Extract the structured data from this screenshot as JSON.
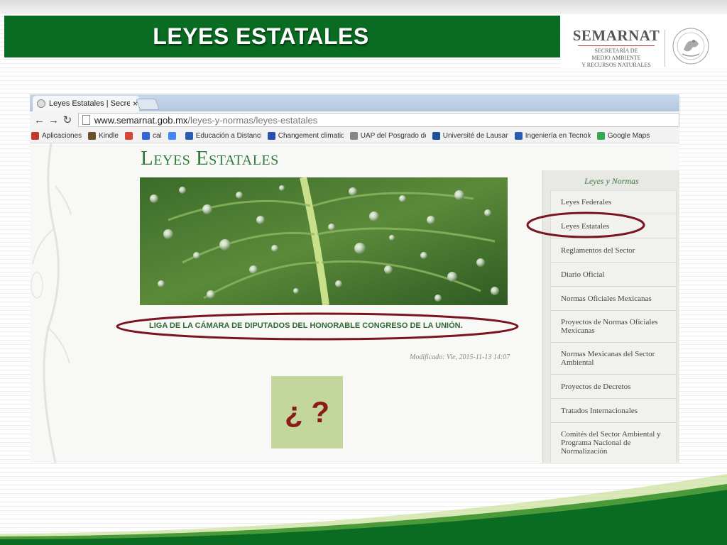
{
  "slide": {
    "title": "LEYES ESTATALES",
    "logo": {
      "name": "SEMARNAT",
      "subtitle_lines": [
        "SECRETARÍA DE",
        "MEDIO AMBIENTE",
        "Y RECURSOS NATURALES"
      ]
    },
    "question_box": {
      "text": "¿ ?",
      "color": "#c3d69b"
    }
  },
  "browser": {
    "tab_title": "Leyes Estatales | Secretaría",
    "tab_close": "×",
    "url_host": "www.semarnat.gob.mx",
    "url_path": "/leyes-y-normas/leyes-estatales",
    "bookmarks": [
      {
        "label": "Aplicaciones",
        "icon": "apps-icon"
      },
      {
        "label": "Kindle",
        "icon": "kindle-icon"
      },
      {
        "label": "",
        "icon": "gmail-icon"
      },
      {
        "label": "cal",
        "icon": "calendar-icon"
      },
      {
        "label": "",
        "icon": "google-icon"
      },
      {
        "label": "Educación a Distancia",
        "icon": "bookmark-icon"
      },
      {
        "label": "Changement climatiq",
        "icon": "flag-icon"
      },
      {
        "label": "UAP del Posgrado de",
        "icon": "document-icon"
      },
      {
        "label": "Université de Lausann",
        "icon": "unil-icon"
      },
      {
        "label": "Ingeniería en Tecnolo",
        "icon": "bookmark-icon"
      },
      {
        "label": "Google Maps",
        "icon": "maps-icon"
      }
    ]
  },
  "webpage": {
    "heading": "Leyes Estatales",
    "link_text": "LIGA DE LA CÁMARA DE DIPUTADOS DEL HONORABLE CONGRESO DE LA UNIÓN.",
    "modified": "Modificado: Vie, 2015-11-13 14:07",
    "sidebar": {
      "title": "Leyes y Normas",
      "items": [
        {
          "label": "Leyes Federales",
          "h": 32
        },
        {
          "label": "Leyes Estatales",
          "h": 33
        },
        {
          "label": "Reglamentos del Sector",
          "h": 33
        },
        {
          "label": "Diario Oficial",
          "h": 33
        },
        {
          "label": "Normas Oficiales Mexicanas",
          "h": 33
        },
        {
          "label": "Proyectos de Normas Oficiales Mexicanas",
          "h": 44
        },
        {
          "label": "Normas Mexicanas del Sector Ambiental",
          "h": 44
        },
        {
          "label": "Proyectos de Decretos",
          "h": 33
        },
        {
          "label": "Tratados Internacionales",
          "h": 33
        },
        {
          "label": "Comités del Sector Ambiental y Programa Nacional de Normalización",
          "h": 56
        }
      ]
    }
  },
  "colors": {
    "header_green": "#0a6b22",
    "annotation_red": "#7a1420",
    "question_mark": "#8b1a1a"
  }
}
